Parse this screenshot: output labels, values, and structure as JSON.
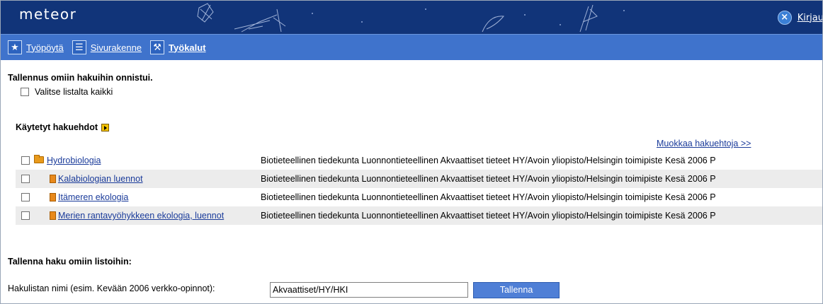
{
  "header": {
    "brand": "meteor",
    "logout_label": "Kirjau",
    "logout_icon": "close-circle-icon"
  },
  "nav": {
    "items": [
      {
        "label": "Työpöytä",
        "icon": "star-icon",
        "bold": false
      },
      {
        "label": "Sivurakenne",
        "icon": "list-icon",
        "bold": false
      },
      {
        "label": "Työkalut",
        "icon": "tools-icon",
        "bold": true
      }
    ]
  },
  "content": {
    "message": "Tallennus omiin hakuihin onnistui.",
    "select_all_label": "Valitse listalta kaikki",
    "used_criteria_title": "Käytetyt hakuehdot",
    "edit_link": "Muokkaa hakuehtoja >>",
    "rows": [
      {
        "name": "Hydrobiologia",
        "icon": "folder-icon",
        "desc": "Biotieteellinen tiedekunta Luonnontieteellinen Akvaattiset tieteet HY/Avoin yliopisto/Helsingin toimipiste Kesä 2006 P"
      },
      {
        "name": "Kalabiologian luennot",
        "icon": "document-icon",
        "desc": "Biotieteellinen tiedekunta Luonnontieteellinen Akvaattiset tieteet HY/Avoin yliopisto/Helsingin toimipiste Kesä 2006 P"
      },
      {
        "name": "Itämeren ekologia",
        "icon": "document-icon",
        "desc": "Biotieteellinen tiedekunta Luonnontieteellinen Akvaattiset tieteet HY/Avoin yliopisto/Helsingin toimipiste Kesä 2006 P"
      },
      {
        "name": "Merien rantavyöhykkeen ekologia, luennot",
        "icon": "document-icon",
        "desc": "Biotieteellinen tiedekunta Luonnontieteellinen Akvaattiset tieteet HY/Avoin yliopisto/Helsingin toimipiste Kesä 2006 P"
      }
    ],
    "save_title": "Tallenna haku omiin listoihin:",
    "save_field_label": "Hakulistan nimi (esim. Kevään 2006 verkko-opinnot):",
    "save_field_value": "Akvaattiset/HY/HKI",
    "save_button": "Tallenna"
  },
  "colors": {
    "header_bg": "#113479",
    "navbar_bg": "#3f73cc",
    "link": "#1a3b9a",
    "button_bg": "#4f7fd6"
  }
}
